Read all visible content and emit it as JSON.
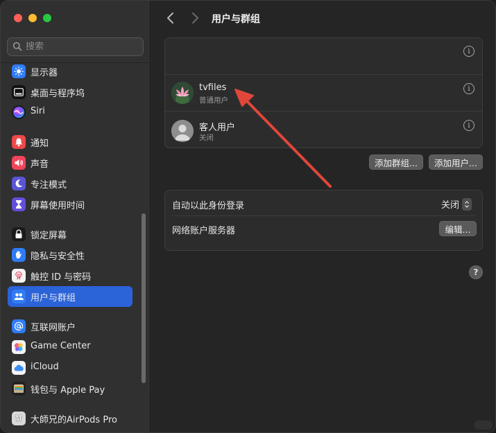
{
  "window": {
    "traffic_lights": {
      "close": "#ff5f57",
      "minimize": "#febc2e",
      "zoom": "#28c840"
    }
  },
  "search": {
    "placeholder": "搜索",
    "value": ""
  },
  "sidebar": {
    "accent": "#2b63d9",
    "items": [
      {
        "label": "显示器",
        "icon": "sun-icon",
        "color": "#2f7cf6",
        "active": false
      },
      {
        "label": "桌面与程序坞",
        "icon": "dock-icon",
        "color": "#111111",
        "active": false
      },
      {
        "label": "Siri",
        "icon": "siri-icon",
        "color": "#1a1a1a",
        "active": false
      },
      {
        "label": "通知",
        "icon": "bell-icon",
        "color": "#f04848",
        "active": false
      },
      {
        "label": "声音",
        "icon": "speaker-icon",
        "color": "#f0445a",
        "active": false
      },
      {
        "label": "专注模式",
        "icon": "moon-icon",
        "color": "#5b55d6",
        "active": false
      },
      {
        "label": "屏幕使用时间",
        "icon": "hourglass-icon",
        "color": "#6250d8",
        "active": false
      },
      {
        "label": "锁定屏幕",
        "icon": "lock-icon",
        "color": "#1b1b1b",
        "active": false
      },
      {
        "label": "隐私与安全性",
        "icon": "hand-icon",
        "color": "#2f7cf6",
        "active": false
      },
      {
        "label": "触控 ID 与密码",
        "icon": "fingerprint-icon",
        "color": "#f4f4f4",
        "active": false
      },
      {
        "label": "用户与群组",
        "icon": "users-icon",
        "color": "#2f7cf6",
        "active": true
      },
      {
        "label": "互联网账户",
        "icon": "at-icon",
        "color": "#2f7cf6",
        "active": false
      },
      {
        "label": "Game Center",
        "icon": "game-center-icon",
        "color": "#f4f4f4",
        "active": false
      },
      {
        "label": "iCloud",
        "icon": "cloud-icon",
        "color": "#f4f4f4",
        "active": false
      },
      {
        "label": "钱包与 Apple Pay",
        "icon": "wallet-icon",
        "color": "#222222",
        "active": false
      },
      {
        "label": "大師兄的AirPods Pro",
        "icon": "airpods-icon",
        "color": "#d8d8d8",
        "active": false
      }
    ]
  },
  "header": {
    "title": "用户与群组"
  },
  "users": [
    {
      "name": "tvfiles",
      "role": "普通用户",
      "avatar": "lotus-avatar"
    },
    {
      "name": "客人用户",
      "role": "关闭",
      "avatar": "generic-user-avatar"
    }
  ],
  "buttons": {
    "add_group": "添加群组...",
    "add_user": "添加用户..."
  },
  "settings": {
    "auto_login_label": "自动以此身份登录",
    "auto_login_value": "关闭",
    "network_server_label": "网络账户服务器",
    "edit_button": "编辑..."
  },
  "help": {
    "label": "?"
  },
  "annotation": {
    "arrow_color": "#e0473a"
  }
}
